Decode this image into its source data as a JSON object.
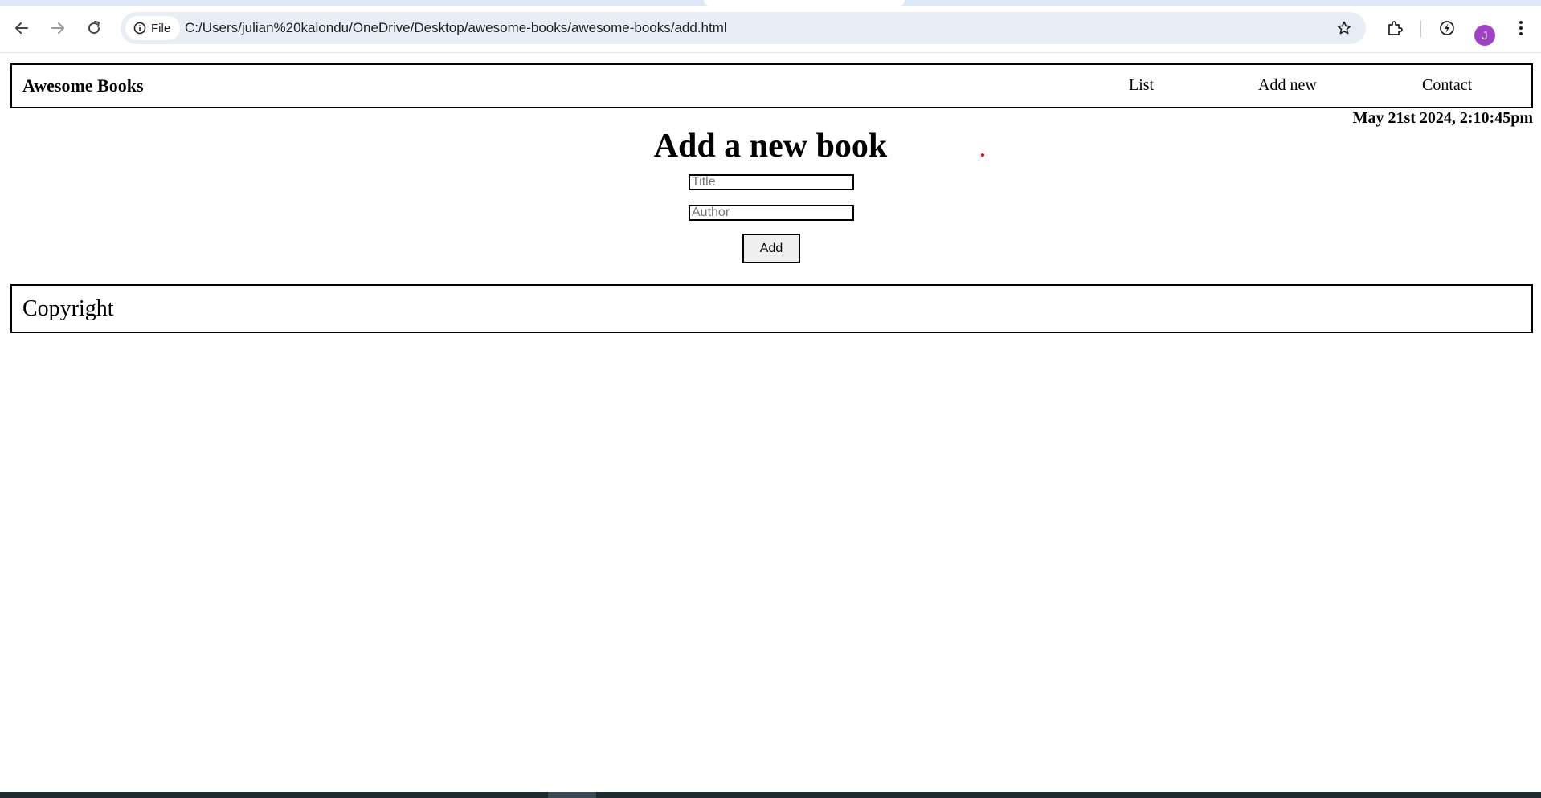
{
  "browser": {
    "site_chip_label": "File",
    "url": "C:/Users/julian%20kalondu/OneDrive/Desktop/awesome-books/awesome-books/add.html",
    "profile_initial": "J",
    "icons": [
      "back-arrow-icon",
      "forward-arrow-icon",
      "reload-icon",
      "info-icon",
      "star-icon",
      "extensions-icon",
      "performance-icon",
      "kebab-menu-icon"
    ]
  },
  "navbar": {
    "brand": "Awesome Books",
    "links": [
      {
        "label": "List"
      },
      {
        "label": "Add new"
      },
      {
        "label": "Contact"
      }
    ]
  },
  "date_text": "May 21st 2024, 2:10:45pm",
  "form": {
    "heading": "Add a new book",
    "title_placeholder": "Title",
    "title_value": "",
    "author_placeholder": "Author",
    "author_value": "",
    "add_label": "Add"
  },
  "footer": {
    "text": "Copyright"
  },
  "colors": {
    "avatar": "#a142c6",
    "omnibox": "#e9eef6",
    "accent_dot": "#e00000"
  }
}
